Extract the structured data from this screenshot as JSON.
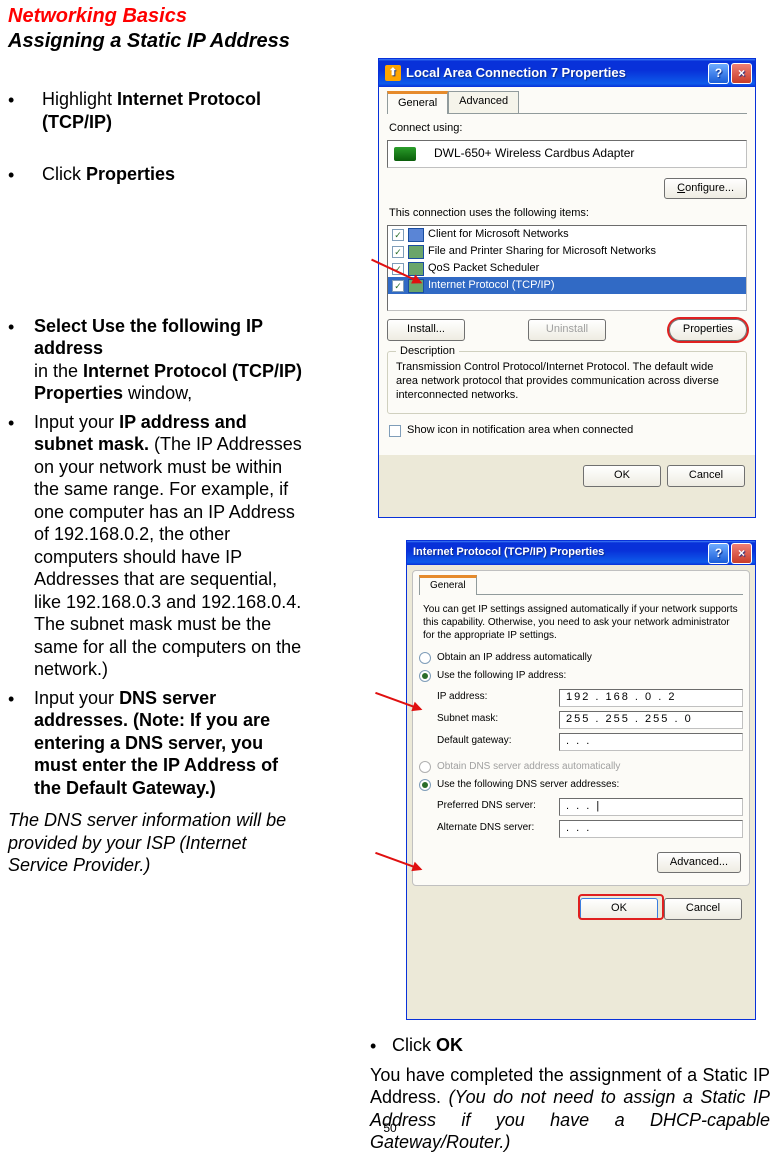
{
  "header": {
    "title_red": "Networking Basics",
    "subtitle": "Assigning a Static IP Address"
  },
  "left_instructions": {
    "b1_pre": "Highlight ",
    "b1_bold": "Internet Protocol (TCP/IP)",
    "b2_pre": "Click ",
    "b2_bold": "Properties",
    "b3_bold": "Select Use the following IP address",
    "b3_mid": " in the ",
    "b3_bold2": "Internet Protocol (TCP/IP) Properties",
    "b3_end": " window,",
    "b4_pre": "Input your ",
    "b4_bold": "IP address and subnet mask.",
    "b4_rest": " (The IP Addresses on your network must be within the same range. For example, if one computer has an IP Address of 192.168.0.2, the other computers should have IP Addresses that are sequential, like 192.168.0.3 and 192.168.0.4.  The subnet mask must be the same for all the computers on the network.)",
    "b5_pre": "Input your ",
    "b5_bold": "DNS server addresses.  (Note:  If you are entering a DNS server, you must enter the IP Address of the Default Gateway.)",
    "isp_note": "The DNS server information will be provided by your ISP (Internet Service Provider.)"
  },
  "right_instructions": {
    "click_pre": "Click ",
    "click_bold": "OK",
    "completed": "You have completed the assignment of a Static IP Address.  ",
    "completed_italic": "(You do not need to assign a Static IP Address if you have a DHCP-capable Gateway/Router.)"
  },
  "dialog1": {
    "title": "Local Area Connection 7 Properties",
    "tabs": {
      "general": "General",
      "advanced": "Advanced"
    },
    "connect_using": "Connect using:",
    "adapter": "DWL-650+ Wireless Cardbus Adapter",
    "configure": "Configure...",
    "uses_label": "This connection uses the following items:",
    "items": {
      "i1": "Client for Microsoft Networks",
      "i2": "File and Printer Sharing for Microsoft Networks",
      "i3": "QoS Packet Scheduler",
      "i4": "Internet Protocol (TCP/IP)"
    },
    "install": "Install...",
    "uninstall": "Uninstall",
    "properties": "Properties",
    "desc_label": "Description",
    "desc_text": "Transmission Control Protocol/Internet Protocol. The default wide area network protocol that provides communication across diverse interconnected networks.",
    "show_icon": "Show icon in notification area when connected",
    "ok": "OK",
    "cancel": "Cancel"
  },
  "dialog2": {
    "title": "Internet Protocol (TCP/IP) Properties",
    "tab": "General",
    "info": "You can get IP settings assigned automatically if your network supports this capability. Otherwise, you need to ask your network administrator for the appropriate IP settings.",
    "r_auto_ip": "Obtain an IP address automatically",
    "r_use_ip": "Use the following IP address:",
    "ip_label": "IP address:",
    "ip_value": "192 . 168 .   0   .   2",
    "subnet_label": "Subnet mask:",
    "subnet_value": "255 . 255 . 255 .   0",
    "gw_label": "Default gateway:",
    "gw_value": "      .        .        .",
    "r_auto_dns": "Obtain DNS server address automatically",
    "r_use_dns": "Use the following DNS server addresses:",
    "pref_dns_label": "Preferred DNS server:",
    "pref_dns_value": "      .        .        . |",
    "alt_dns_label": "Alternate DNS server:",
    "alt_dns_value": "      .        .        .",
    "advanced": "Advanced...",
    "ok": "OK",
    "cancel": "Cancel"
  },
  "page_number": "50"
}
